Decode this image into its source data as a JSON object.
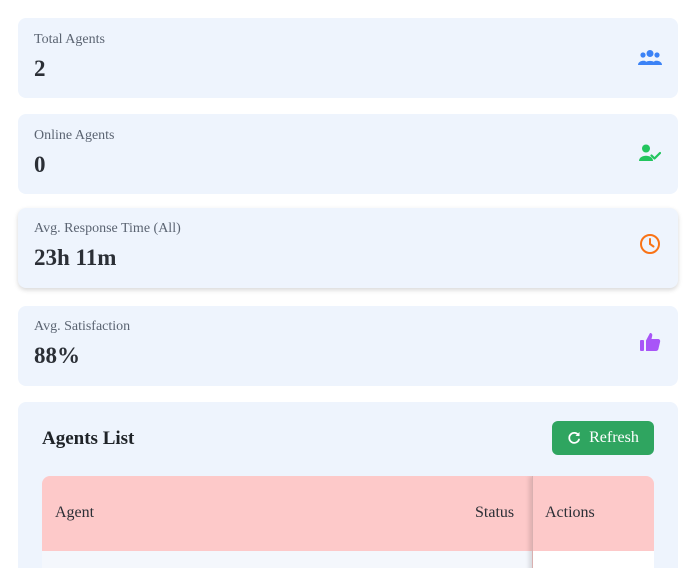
{
  "stats": [
    {
      "label": "Total Agents",
      "value": "2",
      "icon": "users-icon",
      "color": "#3b82f6"
    },
    {
      "label": "Online Agents",
      "value": "0",
      "icon": "user-check-icon",
      "color": "#22c55e"
    },
    {
      "label": "Avg. Response Time (All)",
      "value": "23h 11m",
      "icon": "clock-icon",
      "color": "#f97316"
    },
    {
      "label": "Avg. Satisfaction",
      "value": "88%",
      "icon": "thumbs-up-icon",
      "color": "#a855f7"
    }
  ],
  "agents_panel": {
    "title": "Agents List",
    "refresh_label": "Refresh",
    "refresh_color": "#2fa560",
    "header_color": "#fdc9c9",
    "columns": [
      "Agent",
      "Status",
      "Actions"
    ]
  }
}
